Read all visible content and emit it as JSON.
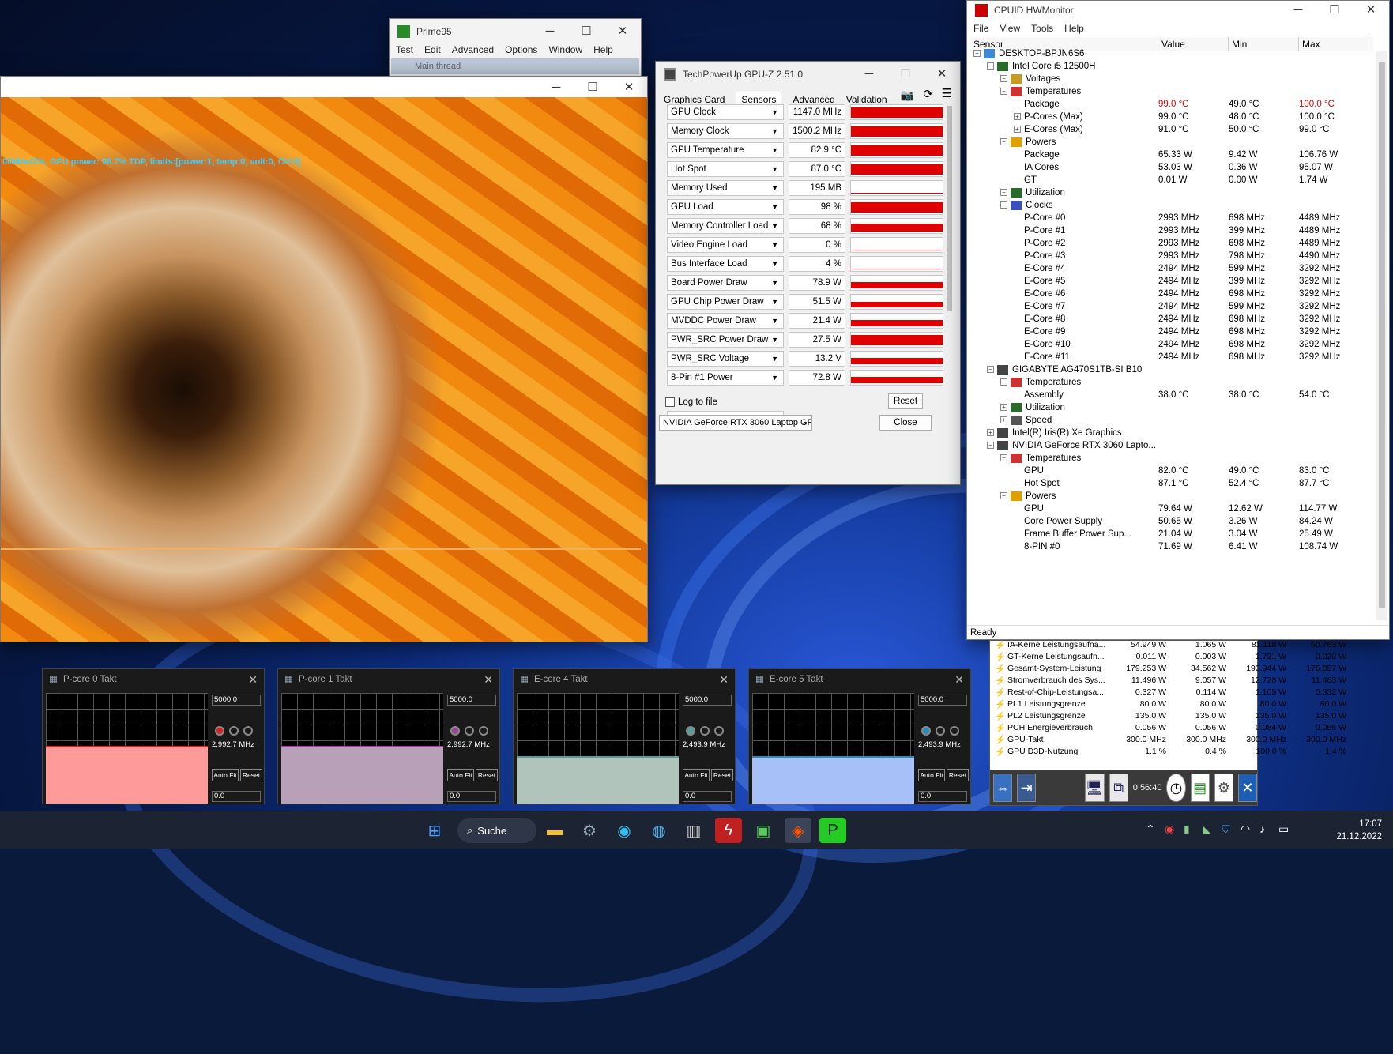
{
  "render": {
    "overlay": "00MHz/3%, GPU power: 98.7% TDP, limits:[power:1, temp:0, volt:0, OV:0]"
  },
  "prime95": {
    "title": "Prime95",
    "menu": [
      "Test",
      "Edit",
      "Advanced",
      "Options",
      "Window",
      "Help"
    ],
    "child": "Main thread"
  },
  "gpuz": {
    "title": "TechPowerUp GPU-Z 2.51.0",
    "tabs": [
      "Graphics Card",
      "Sensors",
      "Advanced",
      "Validation"
    ],
    "sensors": [
      {
        "label": "GPU Clock",
        "value": "1147.0 MHz",
        "level": 0.9
      },
      {
        "label": "Memory Clock",
        "value": "1500.2 MHz",
        "level": 0.9
      },
      {
        "label": "GPU Temperature",
        "value": "82.9 °C",
        "level": 0.9
      },
      {
        "label": "Hot Spot",
        "value": "87.0 °C",
        "level": 0.9
      },
      {
        "label": "Memory Used",
        "value": "195 MB",
        "level": 0.05
      },
      {
        "label": "GPU Load",
        "value": "98 %",
        "level": 0.9
      },
      {
        "label": "Memory Controller Load",
        "value": "68 %",
        "level": 0.7
      },
      {
        "label": "Video Engine Load",
        "value": "0 %",
        "level": 0
      },
      {
        "label": "Bus Interface Load",
        "value": "4 %",
        "level": 0.05
      },
      {
        "label": "Board Power Draw",
        "value": "78.9 W",
        "level": 0.6
      },
      {
        "label": "GPU Chip Power Draw",
        "value": "51.5 W",
        "level": 0.5
      },
      {
        "label": "MVDDC Power Draw",
        "value": "21.4 W",
        "level": 0.6
      },
      {
        "label": "PWR_SRC Power Draw",
        "value": "27.5 W",
        "level": 0.9
      },
      {
        "label": "PWR_SRC Voltage",
        "value": "13.2 V",
        "level": 0.6
      },
      {
        "label": "8-Pin #1 Power",
        "value": "72.8 W",
        "level": 0.6
      }
    ],
    "log": "Log to file",
    "reset": "Reset",
    "device": "NVIDIA GeForce RTX 3060 Laptop GPL",
    "close": "Close"
  },
  "hwm": {
    "title": "CPUID HWMonitor",
    "menu": [
      "File",
      "View",
      "Tools",
      "Help"
    ],
    "cols": [
      "Sensor",
      "Value",
      "Min",
      "Max"
    ],
    "status": "Ready",
    "rows": [
      {
        "d": 0,
        "n": "DESKTOP-BPJN6S6",
        "i": "pc"
      },
      {
        "d": 1,
        "n": "Intel Core i5 12500H",
        "i": "chip"
      },
      {
        "d": 2,
        "n": "Voltages",
        "i": "volt"
      },
      {
        "d": 2,
        "n": "Temperatures",
        "i": "temp"
      },
      {
        "d": 3,
        "n": "Package",
        "v": "99.0 °C",
        "mn": "49.0 °C",
        "mx": "100.0 °C",
        "r": true
      },
      {
        "d": 3,
        "n": "P-Cores (Max)",
        "v": "99.0 °C",
        "mn": "48.0 °C",
        "mx": "100.0 °C",
        "e": true
      },
      {
        "d": 3,
        "n": "E-Cores (Max)",
        "v": "91.0 °C",
        "mn": "50.0 °C",
        "mx": "99.0 °C",
        "e": true
      },
      {
        "d": 2,
        "n": "Powers",
        "i": "pow"
      },
      {
        "d": 3,
        "n": "Package",
        "v": "65.33 W",
        "mn": "9.42 W",
        "mx": "106.76 W"
      },
      {
        "d": 3,
        "n": "IA Cores",
        "v": "53.03 W",
        "mn": "0.36 W",
        "mx": "95.07 W"
      },
      {
        "d": 3,
        "n": "GT",
        "v": "0.01 W",
        "mn": "0.00 W",
        "mx": "1.74 W"
      },
      {
        "d": 2,
        "n": "Utilization",
        "i": "util"
      },
      {
        "d": 2,
        "n": "Clocks",
        "i": "clk"
      },
      {
        "d": 3,
        "n": "P-Core #0",
        "v": "2993 MHz",
        "mn": "698 MHz",
        "mx": "4489 MHz"
      },
      {
        "d": 3,
        "n": "P-Core #1",
        "v": "2993 MHz",
        "mn": "399 MHz",
        "mx": "4489 MHz"
      },
      {
        "d": 3,
        "n": "P-Core #2",
        "v": "2993 MHz",
        "mn": "698 MHz",
        "mx": "4489 MHz"
      },
      {
        "d": 3,
        "n": "P-Core #3",
        "v": "2993 MHz",
        "mn": "798 MHz",
        "mx": "4490 MHz"
      },
      {
        "d": 3,
        "n": "E-Core #4",
        "v": "2494 MHz",
        "mn": "599 MHz",
        "mx": "3292 MHz"
      },
      {
        "d": 3,
        "n": "E-Core #5",
        "v": "2494 MHz",
        "mn": "399 MHz",
        "mx": "3292 MHz"
      },
      {
        "d": 3,
        "n": "E-Core #6",
        "v": "2494 MHz",
        "mn": "698 MHz",
        "mx": "3292 MHz"
      },
      {
        "d": 3,
        "n": "E-Core #7",
        "v": "2494 MHz",
        "mn": "599 MHz",
        "mx": "3292 MHz"
      },
      {
        "d": 3,
        "n": "E-Core #8",
        "v": "2494 MHz",
        "mn": "698 MHz",
        "mx": "3292 MHz"
      },
      {
        "d": 3,
        "n": "E-Core #9",
        "v": "2494 MHz",
        "mn": "698 MHz",
        "mx": "3292 MHz"
      },
      {
        "d": 3,
        "n": "E-Core #10",
        "v": "2494 MHz",
        "mn": "698 MHz",
        "mx": "3292 MHz"
      },
      {
        "d": 3,
        "n": "E-Core #11",
        "v": "2494 MHz",
        "mn": "698 MHz",
        "mx": "3292 MHz"
      },
      {
        "d": 1,
        "n": "GIGABYTE AG470S1TB-SI B10",
        "i": "disk"
      },
      {
        "d": 2,
        "n": "Temperatures",
        "i": "temp"
      },
      {
        "d": 3,
        "n": "Assembly",
        "v": "38.0 °C",
        "mn": "38.0 °C",
        "mx": "54.0 °C"
      },
      {
        "d": 2,
        "n": "Utilization",
        "i": "util",
        "e": true
      },
      {
        "d": 2,
        "n": "Speed",
        "i": "speed",
        "e": true
      },
      {
        "d": 1,
        "n": "Intel(R) Iris(R) Xe Graphics",
        "i": "gpu",
        "e": true
      },
      {
        "d": 1,
        "n": "NVIDIA GeForce RTX 3060 Lapto...",
        "i": "gpu"
      },
      {
        "d": 2,
        "n": "Temperatures",
        "i": "temp"
      },
      {
        "d": 3,
        "n": "GPU",
        "v": "82.0 °C",
        "mn": "49.0 °C",
        "mx": "83.0 °C"
      },
      {
        "d": 3,
        "n": "Hot Spot",
        "v": "87.1 °C",
        "mn": "52.4 °C",
        "mx": "87.7 °C"
      },
      {
        "d": 2,
        "n": "Powers",
        "i": "pow"
      },
      {
        "d": 3,
        "n": "GPU",
        "v": "79.64 W",
        "mn": "12.62 W",
        "mx": "114.77 W"
      },
      {
        "d": 3,
        "n": "Core Power Supply",
        "v": "50.65 W",
        "mn": "3.26 W",
        "mx": "84.24 W"
      },
      {
        "d": 3,
        "n": "Frame Buffer Power Sup...",
        "v": "21.04 W",
        "mn": "3.04 W",
        "mx": "25.49 W"
      },
      {
        "d": 3,
        "n": "8-PIN #0",
        "v": "71.69 W",
        "mn": "6.41 W",
        "mx": "108.74 W"
      }
    ]
  },
  "hwinfo": {
    "rows": [
      [
        "IA-Kerne Leistungsaufna...",
        "54.949 W",
        "1.065 W",
        "81.118 W",
        "50.763 W"
      ],
      [
        "GT-Kerne Leistungsaufn...",
        "0.011 W",
        "0.003 W",
        "1.731 W",
        "0.020 W"
      ],
      [
        "Gesamt-System-Leistung",
        "179.253 W",
        "34.562 W",
        "193.944 W",
        "175.857 W"
      ],
      [
        "Stromverbrauch des Sys...",
        "11.496 W",
        "9.057 W",
        "12.728 W",
        "11.463 W"
      ],
      [
        "Rest-of-Chip-Leistungsa...",
        "0.327 W",
        "0.114 W",
        "1.105 W",
        "0.332 W"
      ],
      [
        "PL1 Leistungsgrenze",
        "80.0 W",
        "80.0 W",
        "80.0 W",
        "80.0 W"
      ],
      [
        "PL2 Leistungsgrenze",
        "135.0 W",
        "135.0 W",
        "135.0 W",
        "135.0 W"
      ],
      [
        "PCH Energieverbrauch",
        "0.056 W",
        "0.056 W",
        "0.084 W",
        "0.056 W"
      ],
      [
        "GPU-Takt",
        "300.0 MHz",
        "300.0 MHz",
        "300.0 MHz",
        "300.0 MHz"
      ],
      [
        "GPU D3D-Nutzung",
        "1.1 %",
        "0.4 %",
        "100.0 %",
        "1.4 %"
      ]
    ],
    "timer": "0:56:40"
  },
  "gadgets": [
    {
      "title": "P-core 0 Takt",
      "max": "5000.0",
      "cur": "2,992.7 MHz",
      "min": "0.0",
      "color": "#ff9a9a",
      "dot": "#e02020",
      "level": 0.52
    },
    {
      "title": "P-core 1 Takt",
      "max": "5000.0",
      "cur": "2,992.7 MHz",
      "min": "0.0",
      "color": "#b8a0b8",
      "dot": "#a040a0",
      "level": 0.52
    },
    {
      "title": "E-core 4 Takt",
      "max": "5000.0",
      "cur": "2,493.9 MHz",
      "min": "0.0",
      "color": "#b0c4bc",
      "dot": "#50a0a0",
      "level": 0.43
    },
    {
      "title": "E-core 5 Takt",
      "max": "5000.0",
      "cur": "2,493.9 MHz",
      "min": "0.0",
      "color": "#a8c0f8",
      "dot": "#2090c0",
      "level": 0.43
    }
  ],
  "gadget_btns": {
    "auto": "Auto Fit",
    "reset": "Reset"
  },
  "taskbar": {
    "search": "Suche",
    "time": "17:07",
    "date": "21.12.2022"
  }
}
